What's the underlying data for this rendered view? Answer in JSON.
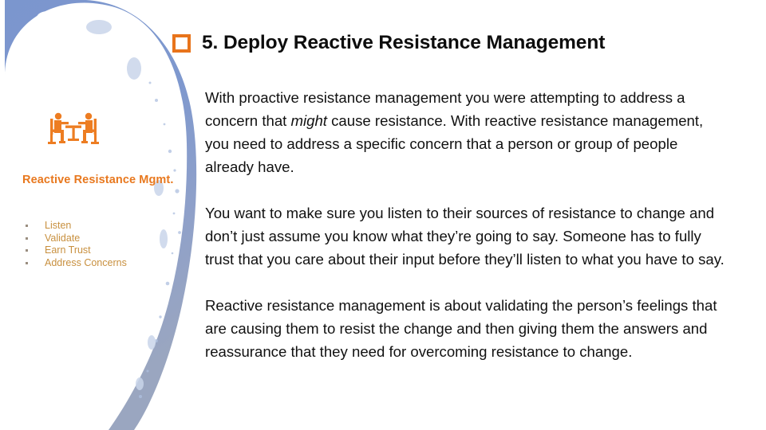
{
  "slide": {
    "title": {
      "number_and_text": "5. Deploy Reactive Resistance Management",
      "checkbox_icon": "empty-checkbox-icon",
      "checkbox_color": "#E8741B",
      "text_color": "#0d0d0d"
    },
    "sidebar": {
      "icon": "two-people-meeting-at-table-icon",
      "icon_color": "#ED7D22",
      "heading": "Reactive Resistance Mgmt.",
      "heading_color": "#E8781E",
      "bullet_color": "#C8903F",
      "bullet_marker_color": "#9a8e80",
      "items": [
        {
          "label": "Listen"
        },
        {
          "label": "Validate"
        },
        {
          "label": "Earn Trust"
        },
        {
          "label": "Address Concerns"
        }
      ]
    },
    "decoration": {
      "name": "blue-brush-stroke-arc",
      "color_primary": "#7B96CE",
      "color_secondary": "#98A6C4",
      "color_light": "#AEC0E0"
    },
    "body": {
      "paragraph_1_part_1": "With proactive resistance management you were attempting to address a concern that ",
      "paragraph_1_emphasis": "might",
      "paragraph_1_part_2": " cause resistance. With reactive resistance management, you need to address a specific concern that a person or group of people already have.",
      "paragraph_2": "You want to make sure you listen to their sources of resistance to change and don’t just assume you know what they’re going to say. Someone has to fully trust that you care about their input before they’ll listen to what you have to say.",
      "paragraph_3": "Reactive resistance management is about validating the person’s feelings that are causing them to resist the change and then giving them the answers and reassurance that they need for overcoming resistance to change.",
      "text_color": "#111111"
    }
  }
}
